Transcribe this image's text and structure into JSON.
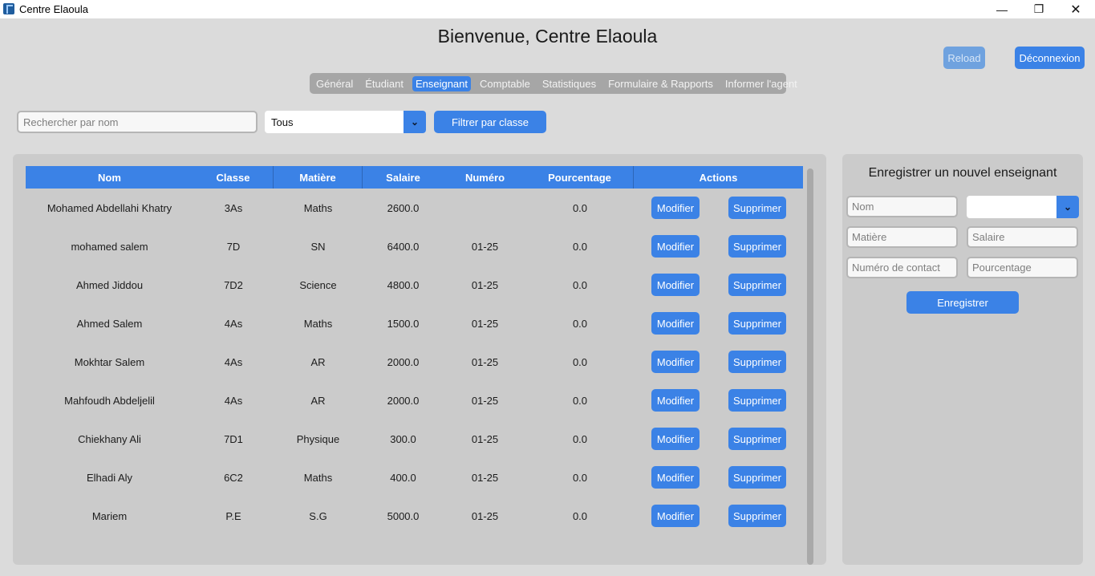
{
  "window": {
    "title": "Centre Elaoula",
    "minimize_icon": "minimize-icon",
    "maximize_icon": "restore-icon",
    "close_icon": "close-icon"
  },
  "header": {
    "welcome": "Bienvenue, Centre Elaoula",
    "reload_label": "Reload",
    "logout_label": "Déconnexion"
  },
  "tabs": [
    {
      "label": "Général",
      "active": false
    },
    {
      "label": "Étudiant",
      "active": false
    },
    {
      "label": "Enseignant",
      "active": true
    },
    {
      "label": "Comptable",
      "active": false
    },
    {
      "label": "Statistiques",
      "active": false
    },
    {
      "label": "Formulaire & Rapports",
      "active": false
    },
    {
      "label": "Informer l'agent",
      "active": false
    }
  ],
  "filter": {
    "search_placeholder": "Rechercher par nom",
    "search_value": "",
    "class_selected": "Tous",
    "filter_button": "Filtrer par classe"
  },
  "table": {
    "columns": [
      "Nom",
      "Classe",
      "Matière",
      "Salaire",
      "Numéro",
      "Pourcentage",
      "Actions"
    ],
    "edit_label": "Modifier",
    "delete_label": "Supprimer",
    "rows": [
      {
        "nom": "Mohamed Abdellahi Khatry",
        "classe": "3As",
        "matiere": "Maths",
        "salaire": "2600.0",
        "numero": "",
        "pourcentage": "0.0"
      },
      {
        "nom": "mohamed salem",
        "classe": "7D",
        "matiere": "SN",
        "salaire": "6400.0",
        "numero": "01-25",
        "pourcentage": "0.0"
      },
      {
        "nom": "Ahmed Jiddou",
        "classe": "7D2",
        "matiere": "Science",
        "salaire": "4800.0",
        "numero": "01-25",
        "pourcentage": "0.0"
      },
      {
        "nom": "Ahmed Salem",
        "classe": "4As",
        "matiere": "Maths",
        "salaire": "1500.0",
        "numero": "01-25",
        "pourcentage": "0.0"
      },
      {
        "nom": "Mokhtar Salem",
        "classe": "4As",
        "matiere": "AR",
        "salaire": "2000.0",
        "numero": "01-25",
        "pourcentage": "0.0"
      },
      {
        "nom": "Mahfoudh Abdeljelil",
        "classe": "4As",
        "matiere": "AR",
        "salaire": "2000.0",
        "numero": "01-25",
        "pourcentage": "0.0"
      },
      {
        "nom": "Chiekhany Ali",
        "classe": "7D1",
        "matiere": "Physique",
        "salaire": "300.0",
        "numero": "01-25",
        "pourcentage": "0.0"
      },
      {
        "nom": "Elhadi Aly",
        "classe": "6C2",
        "matiere": "Maths",
        "salaire": "400.0",
        "numero": "01-25",
        "pourcentage": "0.0"
      },
      {
        "nom": "Mariem",
        "classe": "P.E",
        "matiere": "S.G",
        "salaire": "5000.0",
        "numero": "01-25",
        "pourcentage": "0.0"
      }
    ]
  },
  "form": {
    "title": "Enregistrer un nouvel enseignant",
    "nom_placeholder": "Nom",
    "classe_selected": "",
    "matiere_placeholder": "Matière",
    "salaire_placeholder": "Salaire",
    "numero_placeholder": "Numéro de contact",
    "pourcentage_placeholder": "Pourcentage",
    "submit_label": "Enregistrer"
  },
  "colors": {
    "accent": "#3b82e6",
    "background": "#dbdbdb",
    "panel": "#cbcbcb",
    "tabbar": "#a6a6a6"
  }
}
